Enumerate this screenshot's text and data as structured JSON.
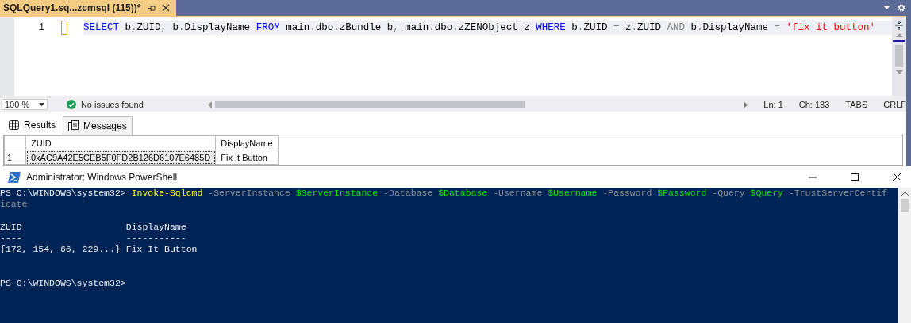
{
  "editor_tab": {
    "title": "SQLQuery1.sq...zcmsql (115))*"
  },
  "editor": {
    "lines": [
      {
        "number": "1",
        "modified": true,
        "tokens": [
          {
            "kind": "keyword",
            "text": "SELECT"
          },
          {
            "kind": "text",
            "text": " b"
          },
          {
            "kind": "operator",
            "text": "."
          },
          {
            "kind": "text",
            "text": "ZUID"
          },
          {
            "kind": "operator",
            "text": ","
          },
          {
            "kind": "text",
            "text": " b"
          },
          {
            "kind": "operator",
            "text": "."
          },
          {
            "kind": "text",
            "text": "DisplayName "
          },
          {
            "kind": "keyword",
            "text": "FROM"
          },
          {
            "kind": "text",
            "text": " main"
          },
          {
            "kind": "operator",
            "text": "."
          },
          {
            "kind": "text",
            "text": "dbo"
          },
          {
            "kind": "operator",
            "text": "."
          },
          {
            "kind": "text",
            "text": "zBundle b"
          },
          {
            "kind": "operator",
            "text": ","
          },
          {
            "kind": "text",
            "text": " main"
          },
          {
            "kind": "operator",
            "text": "."
          },
          {
            "kind": "text",
            "text": "dbo"
          },
          {
            "kind": "operator",
            "text": "."
          },
          {
            "kind": "text",
            "text": "zZENObject z "
          },
          {
            "kind": "keyword",
            "text": "WHERE"
          },
          {
            "kind": "text",
            "text": " b"
          },
          {
            "kind": "operator",
            "text": "."
          },
          {
            "kind": "text",
            "text": "ZUID "
          },
          {
            "kind": "operator",
            "text": "="
          },
          {
            "kind": "text",
            "text": " z"
          },
          {
            "kind": "operator",
            "text": "."
          },
          {
            "kind": "text",
            "text": "ZUID "
          },
          {
            "kind": "operator",
            "text": "AND"
          },
          {
            "kind": "text",
            "text": " b"
          },
          {
            "kind": "operator",
            "text": "."
          },
          {
            "kind": "text",
            "text": "DisplayName "
          },
          {
            "kind": "operator",
            "text": "= "
          },
          {
            "kind": "string",
            "text": "'fix it button'"
          }
        ]
      }
    ]
  },
  "status": {
    "zoom": "100 %",
    "issues": "No issues found",
    "ln": "Ln: 1",
    "ch": "Ch: 133",
    "indent": "TABS",
    "eol": "CRLF"
  },
  "result_tabs": [
    {
      "label": "Results",
      "selected": true,
      "kind": "grid"
    },
    {
      "label": "Messages",
      "selected": false,
      "kind": "messages"
    }
  ],
  "results_grid": {
    "columns": [
      "ZUID",
      "DisplayName"
    ],
    "rows": [
      {
        "number": "1",
        "cells": [
          "0xAC9A42E5CEB5F0FD2B126D6107E6485D",
          "Fix It Button"
        ]
      }
    ]
  },
  "powershell": {
    "title": "Administrator: Windows PowerShell",
    "lines": [
      {
        "kind": "text",
        "tokens": [
          {
            "kind": "prompt",
            "text": "PS C:\\WINDOWS\\system32> "
          },
          {
            "kind": "command",
            "text": "Invoke-Sqlcmd"
          },
          {
            "kind": "parameter",
            "text": " -ServerInstance "
          },
          {
            "kind": "variable",
            "text": "$ServerInstance"
          },
          {
            "kind": "parameter",
            "text": " -Database "
          },
          {
            "kind": "variable",
            "text": "$Database"
          },
          {
            "kind": "parameter",
            "text": " -Username "
          },
          {
            "kind": "variable",
            "text": "$Username"
          },
          {
            "kind": "parameter",
            "text": " -Password "
          },
          {
            "kind": "variable",
            "text": "$Password"
          },
          {
            "kind": "parameter",
            "text": " -Query "
          },
          {
            "kind": "variable",
            "text": "$Query"
          },
          {
            "kind": "parameter",
            "text": " -TrustServerCertif"
          }
        ]
      },
      {
        "kind": "text",
        "tokens": [
          {
            "kind": "parameter",
            "text": "icate"
          }
        ]
      },
      {
        "kind": "blank"
      },
      {
        "kind": "text",
        "tokens": [
          {
            "kind": "output",
            "text": "ZUID                   DisplayName"
          }
        ]
      },
      {
        "kind": "text",
        "tokens": [
          {
            "kind": "output",
            "text": "----                   -----------"
          }
        ]
      },
      {
        "kind": "text",
        "tokens": [
          {
            "kind": "output",
            "text": "{172, 154, 66, 229...} Fix It Button"
          }
        ]
      },
      {
        "kind": "blank"
      },
      {
        "kind": "blank"
      },
      {
        "kind": "text",
        "tokens": [
          {
            "kind": "prompt",
            "text": "PS C:\\WINDOWS\\system32>"
          }
        ]
      }
    ]
  }
}
